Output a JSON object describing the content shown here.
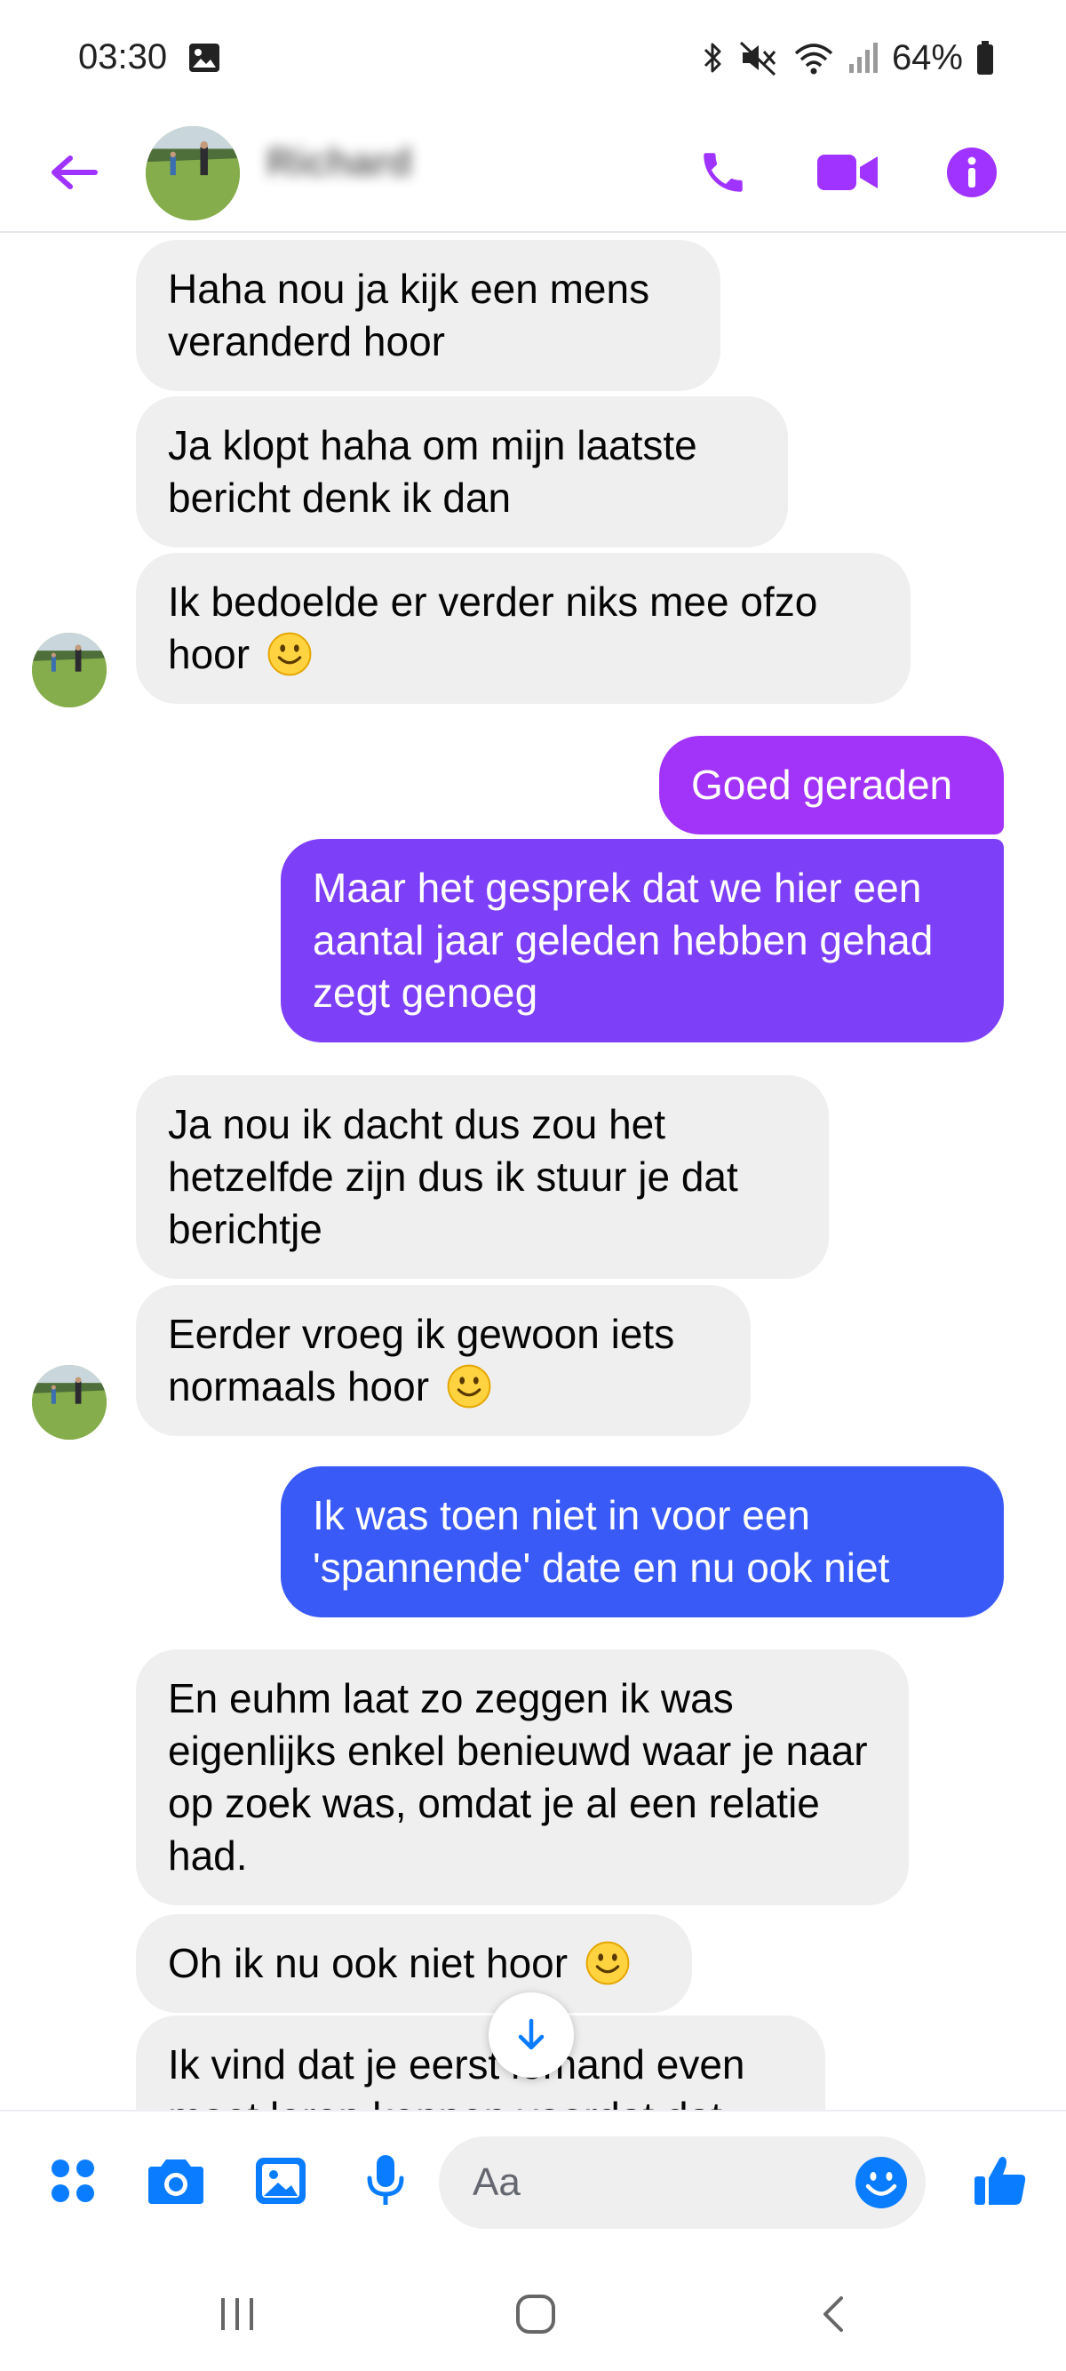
{
  "status_bar": {
    "time": "03:30",
    "battery": "64%",
    "icons": [
      "gallery-icon",
      "bluetooth-icon",
      "mute-vibrate-icon",
      "wifi-icon",
      "signal-icon",
      "battery-icon"
    ]
  },
  "header": {
    "contact_name": "Richard",
    "icons": [
      "back-arrow-icon",
      "phone-icon",
      "video-camera-icon",
      "info-icon"
    ]
  },
  "colors": {
    "accent_purple": "#a033ff",
    "bubble_purple": "#7d3ff8",
    "bubble_blue": "#3a5af8",
    "bubble_incoming": "#efeff0",
    "composer_blue": "#0a7cff"
  },
  "messages": [
    {
      "sender": "contact",
      "text": "Haha nou ja kijk een mens veranderd hoor"
    },
    {
      "sender": "contact",
      "text": "Ja klopt haha om mijn laatste bericht denk ik dan"
    },
    {
      "sender": "contact",
      "text": "Ik bedoelde er verder niks mee ofzo hoor",
      "emoji": "slightly-smiling-face"
    },
    {
      "sender": "me",
      "text": "Goed geraden"
    },
    {
      "sender": "me",
      "text": "Maar het gesprek dat we hier een aantal jaar geleden hebben gehad zegt genoeg"
    },
    {
      "sender": "contact",
      "text": "Ja nou ik dacht dus zou het hetzelfde zijn dus ik stuur je dat berichtje"
    },
    {
      "sender": "contact",
      "text": "Eerder vroeg ik gewoon iets normaals hoor",
      "emoji": "slightly-smiling-face"
    },
    {
      "sender": "me",
      "text": "Ik was toen niet in voor een 'spannende' date en nu ook niet"
    },
    {
      "sender": "contact",
      "text": "En euhm laat zo zeggen ik was eigenlijks enkel benieuwd waar je naar op zoek was, omdat je al een relatie had."
    },
    {
      "sender": "contact",
      "text": "Oh ik nu ook niet hoor",
      "emoji": "slightly-smiling-face"
    },
    {
      "sender": "contact",
      "text": "Ik vind dat je eerst iemand even moet leren kennen voordat dat"
    }
  ],
  "composer": {
    "placeholder": "Aa",
    "icons": [
      "apps-grid-icon",
      "camera-icon",
      "gallery-icon",
      "microphone-icon",
      "emoji-icon",
      "thumbs-up-icon"
    ]
  },
  "navbar": {
    "icons": [
      "recent-apps-icon",
      "home-icon",
      "back-icon"
    ]
  }
}
